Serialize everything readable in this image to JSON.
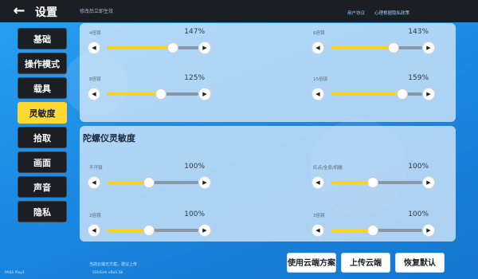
{
  "header": {
    "back_icon": "arrow-left-icon",
    "title": "设置",
    "hint": "修改后立即生效",
    "link_a": "用户协议",
    "link_b": "心理根据隐私政策"
  },
  "sidebar": {
    "items": [
      {
        "label": "基础",
        "active": false
      },
      {
        "label": "操作模式",
        "active": false
      },
      {
        "label": "载具",
        "active": false
      },
      {
        "label": "灵敏度",
        "active": true
      },
      {
        "label": "拾取",
        "active": false
      },
      {
        "label": "画面",
        "active": false
      },
      {
        "label": "声音",
        "active": false
      },
      {
        "label": "隐私",
        "active": false
      }
    ]
  },
  "panel1": {
    "sliders": [
      {
        "label": "4倍镜",
        "value": "147%",
        "fill": 0.72
      },
      {
        "label": "6倍镜",
        "value": "143%",
        "fill": 0.69
      },
      {
        "label": "8倍镜",
        "value": "125%",
        "fill": 0.59
      },
      {
        "label": "15倍镜",
        "value": "159%",
        "fill": 0.78
      }
    ]
  },
  "panel2": {
    "title": "陀螺仪灵敏度",
    "sliders": [
      {
        "label": "不开镜",
        "value": "100%",
        "fill": 0.46
      },
      {
        "label": "红点/全息/机瞄",
        "value": "100%",
        "fill": 0.46
      },
      {
        "label": "2倍镜",
        "value": "100%",
        "fill": 0.46
      },
      {
        "label": "3倍镜",
        "value": "100%",
        "fill": 0.46
      }
    ]
  },
  "footer": {
    "hint": "当前云端无方案，建议上传",
    "version": "PASS Play1",
    "version2": "SShSinh aBaS Sb",
    "cloud_label": "使用云端方案",
    "upload_label": "上传云端",
    "reset_label": "恢复默认"
  },
  "colors": {
    "accent": "#ffd933",
    "topbar": "#1b1f24",
    "background": "#1f8fe8"
  }
}
